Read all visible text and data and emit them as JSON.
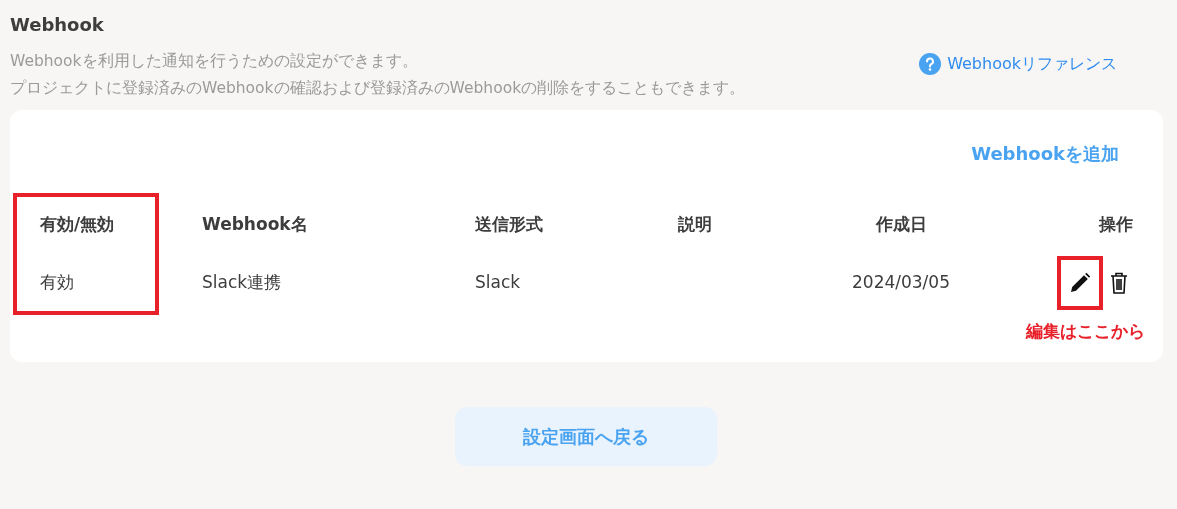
{
  "section": {
    "title": "Webhook",
    "description": [
      "Webhookを利用した通知を行うための設定ができます。",
      "プロジェクトに登録済みのWebhookの確認および登録済みのWebhookの削除をすることもできます。"
    ],
    "reference_link": "Webhookリファレンス"
  },
  "card": {
    "add_link": "Webhookを追加",
    "table": {
      "columns": [
        {
          "label": "有効/無効",
          "highlight": true
        },
        {
          "label": "Webhook名",
          "highlight": false
        },
        {
          "label": "送信形式",
          "highlight": false
        },
        {
          "label": "説明",
          "highlight": false
        },
        {
          "label": "作成日",
          "highlight": false
        },
        {
          "label": "操作",
          "highlight": false
        }
      ],
      "rows": [
        {
          "cells": [
            "有効",
            "Slack連携",
            "Slack",
            "",
            "2024/03/05"
          ],
          "actions": [
            {
              "kind": "edit",
              "highlight": true
            },
            {
              "kind": "delete",
              "highlight": false
            }
          ]
        }
      ]
    },
    "note": "編集はここから"
  },
  "back_button": "設定画面へ戻る"
}
